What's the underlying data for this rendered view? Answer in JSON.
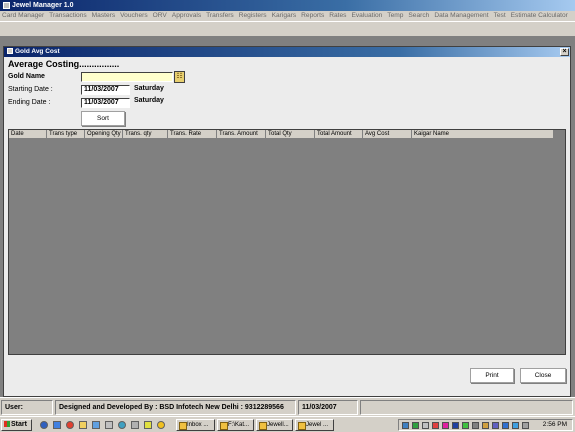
{
  "app": {
    "title": "Jewel Manager 1.0"
  },
  "menu": [
    "Card Manager",
    "Transactions",
    "Masters",
    "Vouchers",
    "ORV",
    "Approvals",
    "Transfers",
    "Registers",
    "Karigars",
    "Reports",
    "Rates",
    "Evaluation",
    "Temp",
    "Search",
    "Data Management",
    "Test",
    "Estimate Calculator"
  ],
  "window": {
    "title": "Gold Avg Cost",
    "close_glyph": "×",
    "heading": "Average Costing................",
    "gold_name_label": "Gold Name",
    "gold_name_value": "",
    "lookup_glyph": "☷",
    "start_label": "Starting Date   :",
    "start_value": "11/03/2007",
    "start_day": "Saturday",
    "end_label": "Ending Date    :",
    "end_value": "11/03/2007",
    "end_day": "Saturday",
    "sort_label": "Sort",
    "print_label": "Print",
    "close_label": "Close"
  },
  "grid": {
    "columns": [
      "Date",
      "Trans type",
      "Opening Qty",
      "Trans. qty",
      "Trans. Rate",
      "Trans. Amount",
      "Total Qty",
      "Total Amount",
      "Avg Cost",
      "Kaigar Name"
    ]
  },
  "status": {
    "user": "User:",
    "credit": "Designed and Developed By : BSD Infotech New Delhi : 9312289566",
    "date": "11/03/2007"
  },
  "taskbar": {
    "start": "Start",
    "tasks": [
      "Inbox ...",
      "F:\\Kat...",
      "Jewell...",
      "Jewel ..."
    ],
    "clock": "2:56 PM"
  },
  "colors": {
    "titlebar": "#0a246a",
    "grid_bg": "#808080",
    "gold_field": "#ffffcc"
  }
}
